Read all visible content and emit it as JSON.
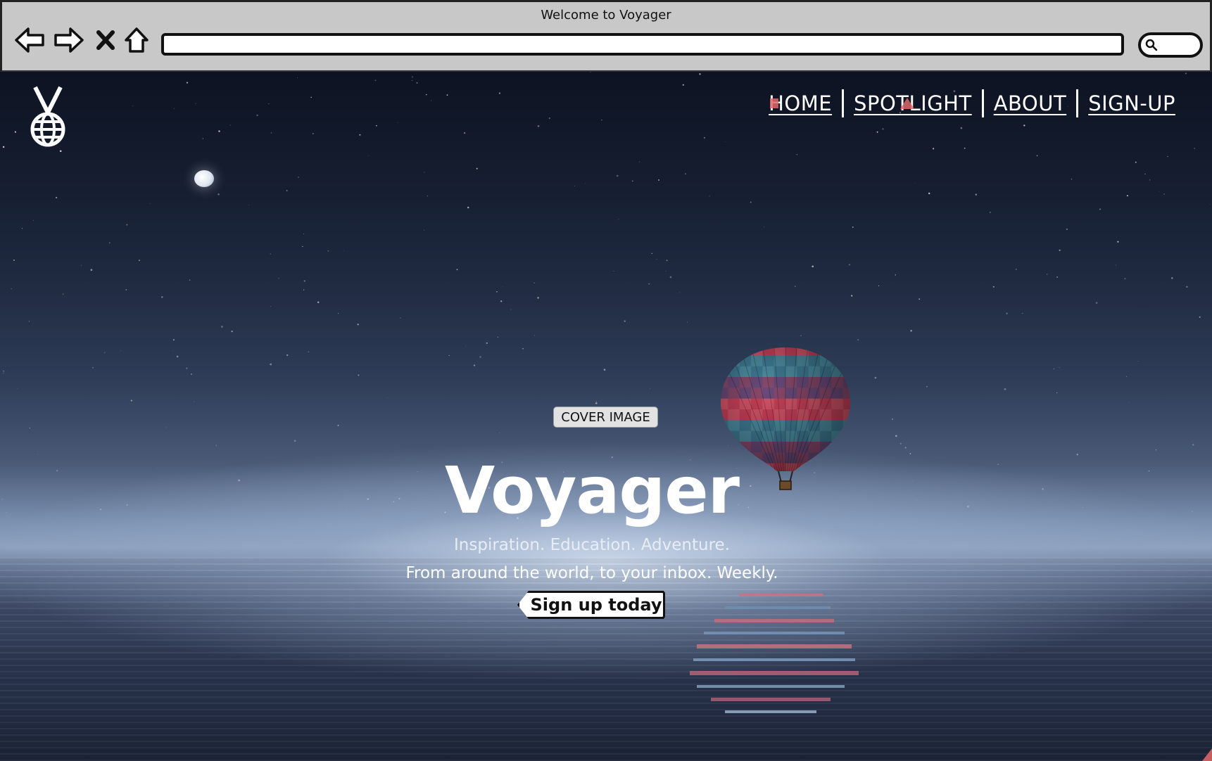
{
  "browser": {
    "title": "Welcome to Voyager",
    "url": "",
    "back_icon": "back-arrow-icon",
    "forward_icon": "forward-arrow-icon",
    "stop_icon": "close-icon",
    "home_icon": "home-icon",
    "search_icon": "search-icon"
  },
  "site": {
    "logo_icon": "voyager-globe-logo-icon",
    "nav": [
      {
        "label": "HOME"
      },
      {
        "label": "SPOTLIGHT"
      },
      {
        "label": "ABOUT"
      },
      {
        "label": "SIGN-UP"
      }
    ]
  },
  "hero": {
    "cover_label": "COVER IMAGE",
    "title": "Voyager",
    "tagline": "Inspiration. Education. Adventure.",
    "subtitle": "From around the world, to your inbox. Weekly.",
    "cta_label": "Sign up today"
  },
  "colors": {
    "chrome_bg": "#c8c8c8",
    "sky_top": "#0d1322",
    "horizon_glow": "#cddaec",
    "text": "#ffffff",
    "accent_mark": "#e06868"
  }
}
